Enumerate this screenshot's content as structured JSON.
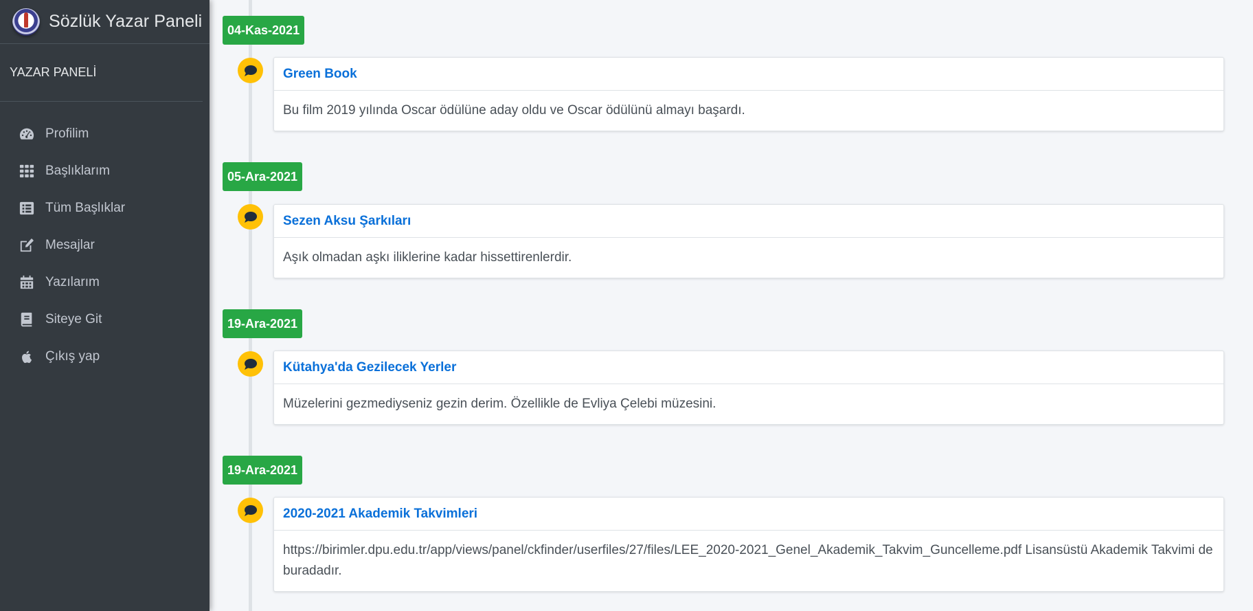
{
  "sidebar": {
    "brand_title": "Sözlük Yazar Paneli",
    "section_title": "YAZAR PANELİ",
    "items": [
      {
        "label": "Profilim",
        "icon": "dashboard-icon"
      },
      {
        "label": "Başlıklarım",
        "icon": "grid-icon"
      },
      {
        "label": "Tüm Başlıklar",
        "icon": "list-icon"
      },
      {
        "label": "Mesajlar",
        "icon": "edit-icon"
      },
      {
        "label": "Yazılarım",
        "icon": "calendar-icon"
      },
      {
        "label": "Siteye Git",
        "icon": "book-icon"
      },
      {
        "label": "Çıkış yap",
        "icon": "apple-icon"
      }
    ]
  },
  "timeline": [
    {
      "date": "04-Kas-2021",
      "title": "Green Book",
      "body": "Bu film 2019 yılında Oscar ödülüne aday oldu ve Oscar ödülünü almayı başardı."
    },
    {
      "date": "05-Ara-2021",
      "title": "Sezen Aksu Şarkıları",
      "body": "Aşık olmadan aşkı iliklerine kadar hissettirenlerdir."
    },
    {
      "date": "19-Ara-2021",
      "title": "Kütahya'da Gezilecek Yerler",
      "body": "Müzelerini gezmediyseniz gezin derim. Özellikle de Evliya Çelebi müzesini."
    },
    {
      "date": "19-Ara-2021",
      "title": "2020-2021 Akademik Takvimleri",
      "body": "https://birimler.dpu.edu.tr/app/views/panel/ckfinder/userfiles/27/files/LEE_2020-2021_Genel_Akademik_Takvim_Guncelleme.pdf Lisansüstü Akademik Takvimi de buradadır."
    }
  ],
  "colors": {
    "sidebar_bg": "#343a40",
    "date_badge": "#28a745",
    "marker": "#ffc107",
    "link": "#0a70d9"
  }
}
